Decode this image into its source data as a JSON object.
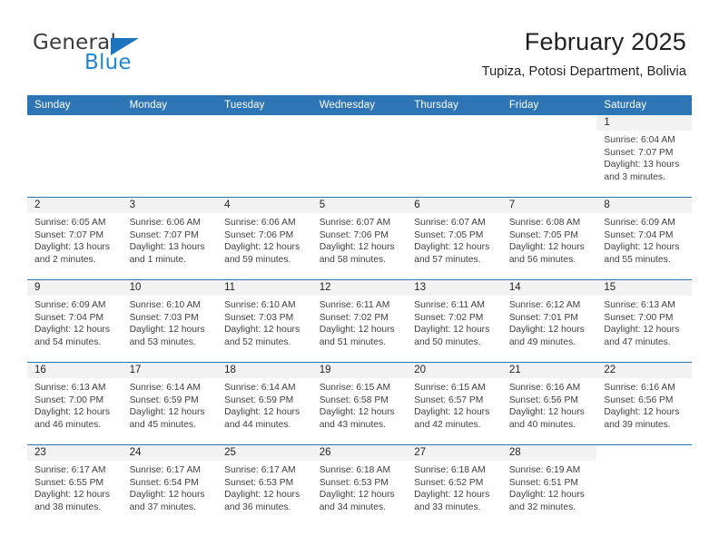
{
  "brand": {
    "name_part1": "General",
    "name_part2": "Blue",
    "triangle_color": "#1e73be",
    "blue_text_color": "#1e87d6"
  },
  "header": {
    "title": "February 2025",
    "subtitle": "Tupiza, Potosi Department, Bolivia"
  },
  "colors": {
    "header_blue": "#2e75b6",
    "day_band_gray": "#f2f2f2",
    "text": "#231f20"
  },
  "weekday_headers": [
    "Sunday",
    "Monday",
    "Tuesday",
    "Wednesday",
    "Thursday",
    "Friday",
    "Saturday"
  ],
  "weeks": [
    [
      {
        "day": "",
        "sunrise": "",
        "sunset": "",
        "daylight": "",
        "blank": true
      },
      {
        "day": "",
        "sunrise": "",
        "sunset": "",
        "daylight": "",
        "blank": true
      },
      {
        "day": "",
        "sunrise": "",
        "sunset": "",
        "daylight": "",
        "blank": true
      },
      {
        "day": "",
        "sunrise": "",
        "sunset": "",
        "daylight": "",
        "blank": true
      },
      {
        "day": "",
        "sunrise": "",
        "sunset": "",
        "daylight": "",
        "blank": true
      },
      {
        "day": "",
        "sunrise": "",
        "sunset": "",
        "daylight": "",
        "blank": true
      },
      {
        "day": "1",
        "sunrise": "Sunrise: 6:04 AM",
        "sunset": "Sunset: 7:07 PM",
        "daylight": "Daylight: 13 hours and 3 minutes."
      }
    ],
    [
      {
        "day": "2",
        "sunrise": "Sunrise: 6:05 AM",
        "sunset": "Sunset: 7:07 PM",
        "daylight": "Daylight: 13 hours and 2 minutes."
      },
      {
        "day": "3",
        "sunrise": "Sunrise: 6:06 AM",
        "sunset": "Sunset: 7:07 PM",
        "daylight": "Daylight: 13 hours and 1 minute."
      },
      {
        "day": "4",
        "sunrise": "Sunrise: 6:06 AM",
        "sunset": "Sunset: 7:06 PM",
        "daylight": "Daylight: 12 hours and 59 minutes."
      },
      {
        "day": "5",
        "sunrise": "Sunrise: 6:07 AM",
        "sunset": "Sunset: 7:06 PM",
        "daylight": "Daylight: 12 hours and 58 minutes."
      },
      {
        "day": "6",
        "sunrise": "Sunrise: 6:07 AM",
        "sunset": "Sunset: 7:05 PM",
        "daylight": "Daylight: 12 hours and 57 minutes."
      },
      {
        "day": "7",
        "sunrise": "Sunrise: 6:08 AM",
        "sunset": "Sunset: 7:05 PM",
        "daylight": "Daylight: 12 hours and 56 minutes."
      },
      {
        "day": "8",
        "sunrise": "Sunrise: 6:09 AM",
        "sunset": "Sunset: 7:04 PM",
        "daylight": "Daylight: 12 hours and 55 minutes."
      }
    ],
    [
      {
        "day": "9",
        "sunrise": "Sunrise: 6:09 AM",
        "sunset": "Sunset: 7:04 PM",
        "daylight": "Daylight: 12 hours and 54 minutes."
      },
      {
        "day": "10",
        "sunrise": "Sunrise: 6:10 AM",
        "sunset": "Sunset: 7:03 PM",
        "daylight": "Daylight: 12 hours and 53 minutes."
      },
      {
        "day": "11",
        "sunrise": "Sunrise: 6:10 AM",
        "sunset": "Sunset: 7:03 PM",
        "daylight": "Daylight: 12 hours and 52 minutes."
      },
      {
        "day": "12",
        "sunrise": "Sunrise: 6:11 AM",
        "sunset": "Sunset: 7:02 PM",
        "daylight": "Daylight: 12 hours and 51 minutes."
      },
      {
        "day": "13",
        "sunrise": "Sunrise: 6:11 AM",
        "sunset": "Sunset: 7:02 PM",
        "daylight": "Daylight: 12 hours and 50 minutes."
      },
      {
        "day": "14",
        "sunrise": "Sunrise: 6:12 AM",
        "sunset": "Sunset: 7:01 PM",
        "daylight": "Daylight: 12 hours and 49 minutes."
      },
      {
        "day": "15",
        "sunrise": "Sunrise: 6:13 AM",
        "sunset": "Sunset: 7:00 PM",
        "daylight": "Daylight: 12 hours and 47 minutes."
      }
    ],
    [
      {
        "day": "16",
        "sunrise": "Sunrise: 6:13 AM",
        "sunset": "Sunset: 7:00 PM",
        "daylight": "Daylight: 12 hours and 46 minutes."
      },
      {
        "day": "17",
        "sunrise": "Sunrise: 6:14 AM",
        "sunset": "Sunset: 6:59 PM",
        "daylight": "Daylight: 12 hours and 45 minutes."
      },
      {
        "day": "18",
        "sunrise": "Sunrise: 6:14 AM",
        "sunset": "Sunset: 6:59 PM",
        "daylight": "Daylight: 12 hours and 44 minutes."
      },
      {
        "day": "19",
        "sunrise": "Sunrise: 6:15 AM",
        "sunset": "Sunset: 6:58 PM",
        "daylight": "Daylight: 12 hours and 43 minutes."
      },
      {
        "day": "20",
        "sunrise": "Sunrise: 6:15 AM",
        "sunset": "Sunset: 6:57 PM",
        "daylight": "Daylight: 12 hours and 42 minutes."
      },
      {
        "day": "21",
        "sunrise": "Sunrise: 6:16 AM",
        "sunset": "Sunset: 6:56 PM",
        "daylight": "Daylight: 12 hours and 40 minutes."
      },
      {
        "day": "22",
        "sunrise": "Sunrise: 6:16 AM",
        "sunset": "Sunset: 6:56 PM",
        "daylight": "Daylight: 12 hours and 39 minutes."
      }
    ],
    [
      {
        "day": "23",
        "sunrise": "Sunrise: 6:17 AM",
        "sunset": "Sunset: 6:55 PM",
        "daylight": "Daylight: 12 hours and 38 minutes."
      },
      {
        "day": "24",
        "sunrise": "Sunrise: 6:17 AM",
        "sunset": "Sunset: 6:54 PM",
        "daylight": "Daylight: 12 hours and 37 minutes."
      },
      {
        "day": "25",
        "sunrise": "Sunrise: 6:17 AM",
        "sunset": "Sunset: 6:53 PM",
        "daylight": "Daylight: 12 hours and 36 minutes."
      },
      {
        "day": "26",
        "sunrise": "Sunrise: 6:18 AM",
        "sunset": "Sunset: 6:53 PM",
        "daylight": "Daylight: 12 hours and 34 minutes."
      },
      {
        "day": "27",
        "sunrise": "Sunrise: 6:18 AM",
        "sunset": "Sunset: 6:52 PM",
        "daylight": "Daylight: 12 hours and 33 minutes."
      },
      {
        "day": "28",
        "sunrise": "Sunrise: 6:19 AM",
        "sunset": "Sunset: 6:51 PM",
        "daylight": "Daylight: 12 hours and 32 minutes."
      },
      {
        "day": "",
        "sunrise": "",
        "sunset": "",
        "daylight": "",
        "blank": true
      }
    ]
  ]
}
